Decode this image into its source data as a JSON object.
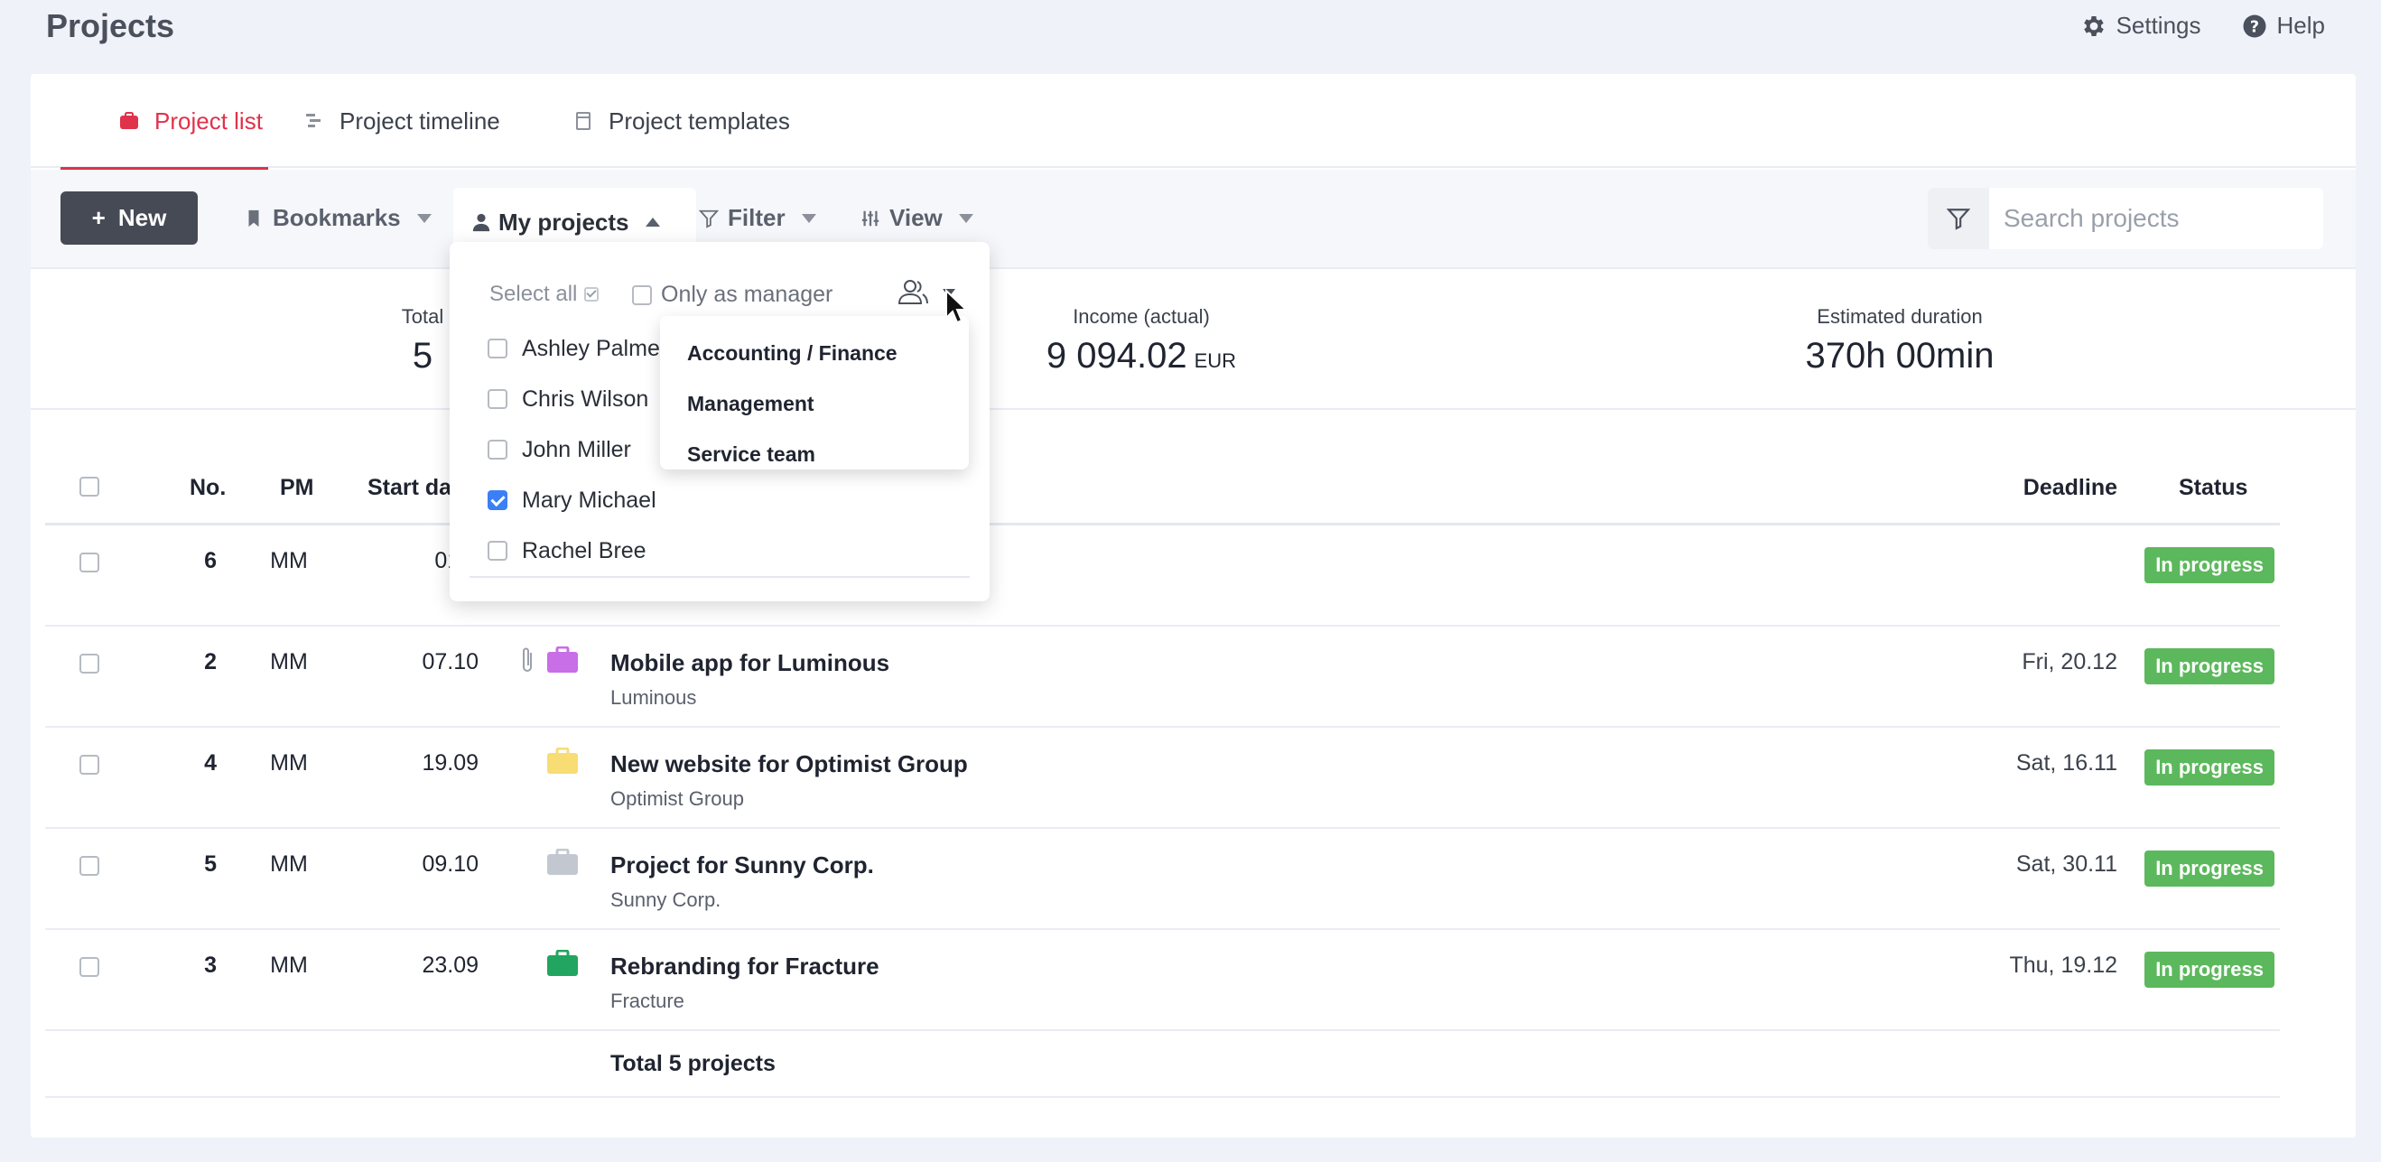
{
  "header": {
    "title": "Projects",
    "settings_label": "Settings",
    "help_label": "Help"
  },
  "tabs": [
    {
      "label": "Project list",
      "active": true
    },
    {
      "label": "Project timeline",
      "active": false
    },
    {
      "label": "Project templates",
      "active": false
    }
  ],
  "toolbar": {
    "new_label": "New",
    "bookmarks_label": "Bookmarks",
    "my_projects_label": "My projects",
    "filter_label": "Filter",
    "view_label": "View",
    "search_placeholder": "Search projects"
  },
  "stats": {
    "total_label": "Total",
    "total_value": "5",
    "income_label": "Income (actual)",
    "income_value": "9 094.02",
    "income_unit": "EUR",
    "duration_label": "Estimated duration",
    "duration_value": "370h 00min"
  },
  "table": {
    "columns": {
      "no": "No.",
      "pm": "PM",
      "start_date": "Start da",
      "deadline": "Deadline",
      "status": "Status"
    },
    "rows": [
      {
        "no": "6",
        "pm": "MM",
        "start": "01.0",
        "name": "",
        "client": "",
        "deadline": "",
        "status": "In progress",
        "bag_color": "",
        "attachment": false
      },
      {
        "no": "2",
        "pm": "MM",
        "start": "07.10",
        "name": "Mobile app for Luminous",
        "client": "Luminous",
        "deadline": "Fri, 20.12",
        "status": "In progress",
        "bag_color": "#c86ee6",
        "attachment": true
      },
      {
        "no": "4",
        "pm": "MM",
        "start": "19.09",
        "name": "New website for Optimist Group",
        "client": "Optimist Group",
        "deadline": "Sat, 16.11",
        "status": "In progress",
        "bag_color": "#f8dc74",
        "attachment": false
      },
      {
        "no": "5",
        "pm": "MM",
        "start": "09.10",
        "name": "Project for Sunny Corp.",
        "client": "Sunny Corp.",
        "deadline": "Sat, 30.11",
        "status": "In progress",
        "bag_color": "#c3c8d0",
        "attachment": false
      },
      {
        "no": "3",
        "pm": "MM",
        "start": "23.09",
        "name": "Rebranding for Fracture",
        "client": "Fracture",
        "deadline": "Thu, 19.12",
        "status": "In progress",
        "bag_color": "#22a560",
        "attachment": false
      }
    ],
    "total_label": "Total 5 projects"
  },
  "dropdown": {
    "select_all_label": "Select all",
    "only_manager_label": "Only as manager",
    "people": [
      {
        "name": "Ashley Palme",
        "checked": false
      },
      {
        "name": "Chris Wilson",
        "checked": false
      },
      {
        "name": "John Miller",
        "checked": false
      },
      {
        "name": "Mary Michael",
        "checked": true
      },
      {
        "name": "Rachel Bree",
        "checked": false
      }
    ],
    "groups": [
      "Accounting / Finance",
      "Management",
      "Service team"
    ]
  },
  "colors": {
    "accent": "#e0324b",
    "status_green": "#5cb85c",
    "primary_button": "#454a55",
    "checkbox_on": "#3a7ff6"
  }
}
